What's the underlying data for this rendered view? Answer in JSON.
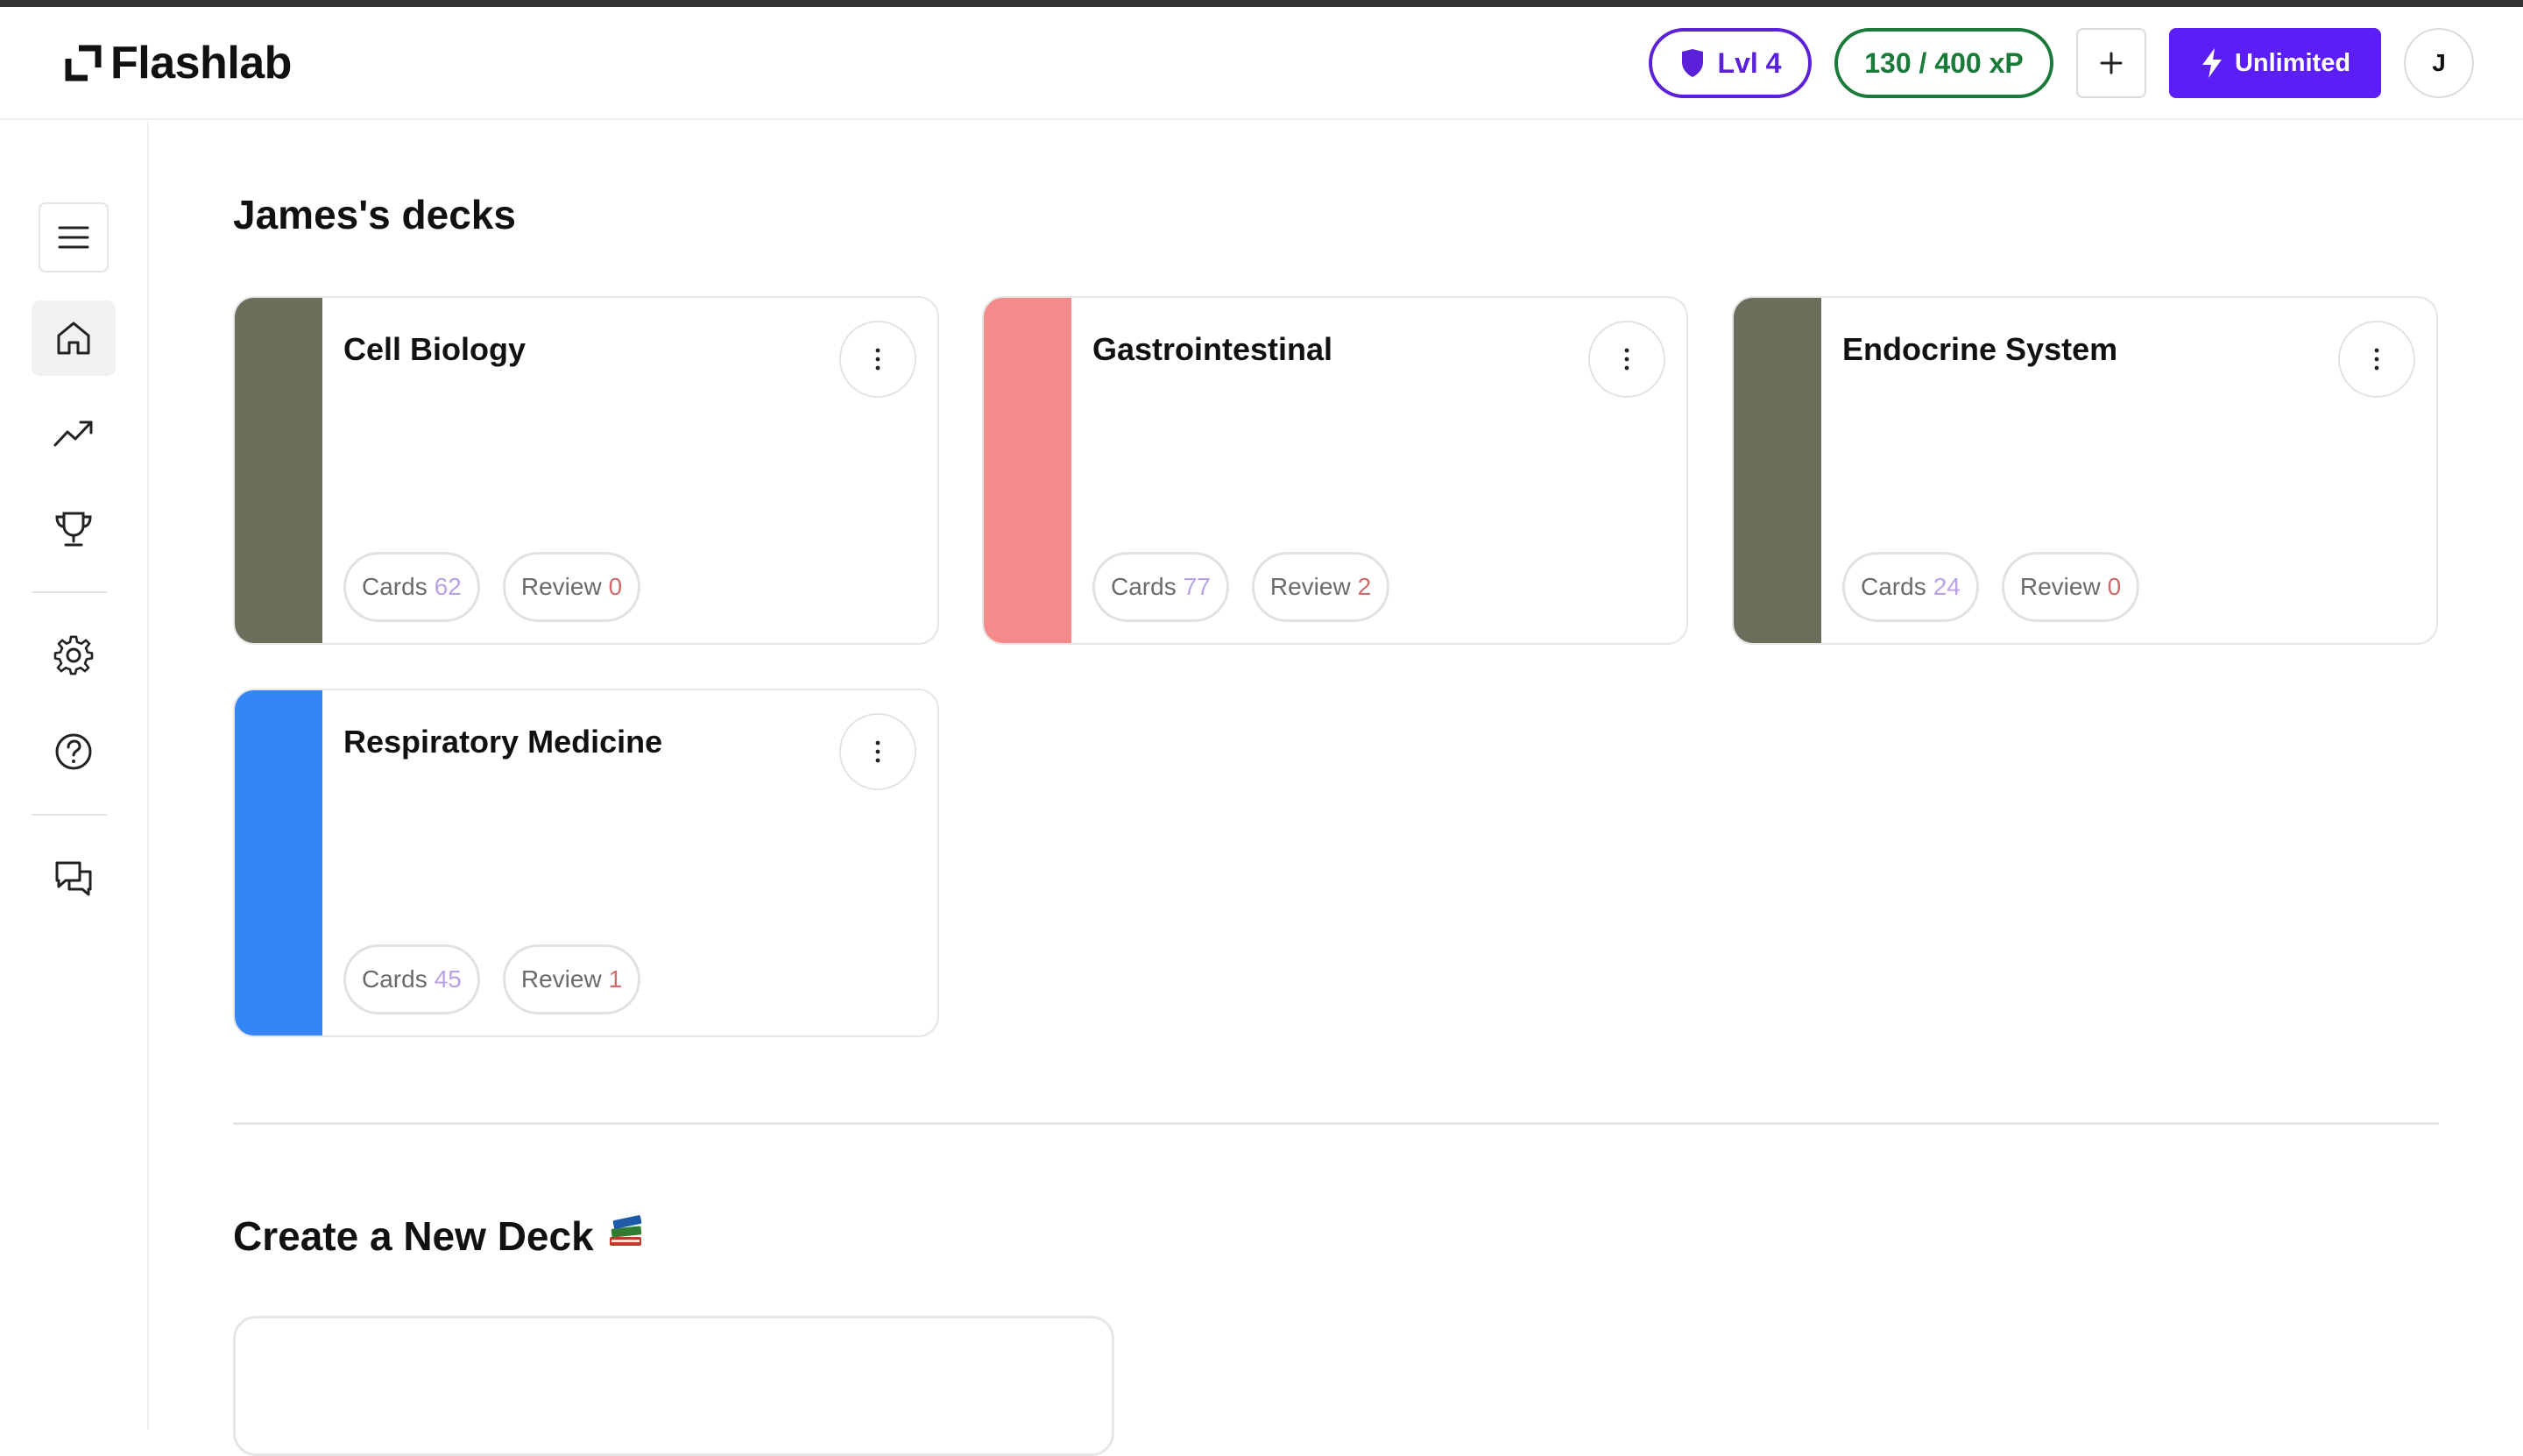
{
  "app": {
    "name": "Flashlab"
  },
  "header": {
    "level_label": "Lvl 4",
    "xp_label": "130 / 400 xP",
    "unlimited_label": "Unlimited",
    "avatar_initial": "J",
    "level_color": "#5b21d8",
    "xp_color": "#1a7a3a",
    "unlimited_color": "#5b1ff5"
  },
  "sidebar": {
    "items": [
      {
        "icon": "menu-icon"
      },
      {
        "icon": "home-icon",
        "active": true
      },
      {
        "icon": "trending-up-icon"
      },
      {
        "icon": "trophy-icon"
      },
      {
        "icon": "gear-icon"
      },
      {
        "icon": "help-circle-icon"
      },
      {
        "icon": "chat-bubbles-icon"
      }
    ]
  },
  "main": {
    "decks_title": "James's decks",
    "create_title": "Create a New Deck",
    "create_emoji": "📚",
    "cards_label": "Cards",
    "review_label": "Review",
    "decks": [
      {
        "name": "Cell Biology",
        "cards": "62",
        "review": "0",
        "color": "#6b6e5a"
      },
      {
        "name": "Gastrointestinal",
        "cards": "77",
        "review": "2",
        "color": "#f38b8a"
      },
      {
        "name": "Endocrine System",
        "cards": "24",
        "review": "0",
        "color": "#6b6e5a"
      },
      {
        "name": "Respiratory Medicine",
        "cards": "45",
        "review": "1",
        "color": "#3385f8"
      }
    ]
  }
}
